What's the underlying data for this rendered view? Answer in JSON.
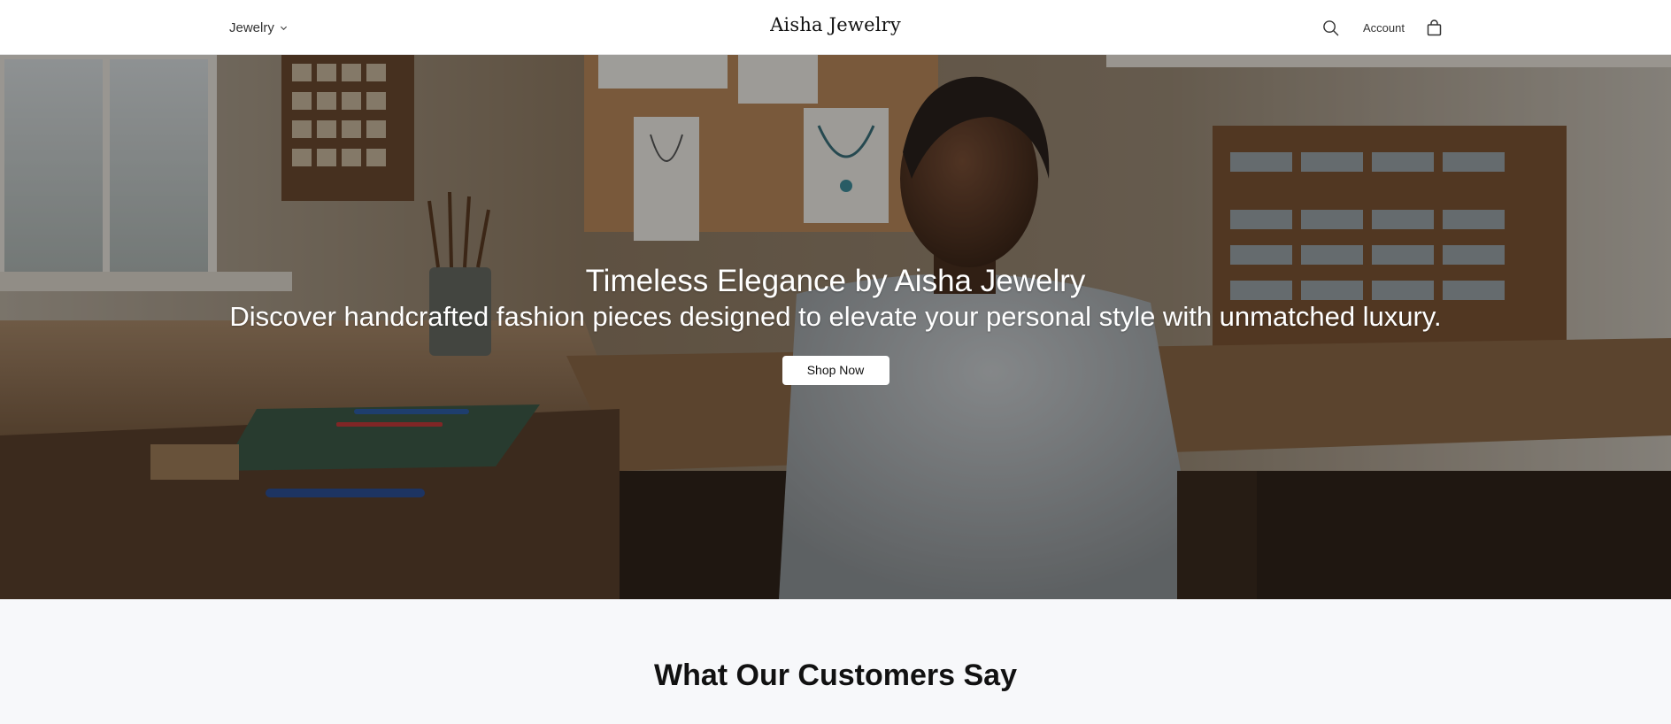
{
  "header": {
    "nav_label": "Jewelry",
    "brand": "Aisha Jewelry",
    "account_label": "Account",
    "icons": {
      "menu_chevron": "chevron-down-icon",
      "search": "search-icon",
      "cart": "shopping-bag-icon"
    }
  },
  "hero": {
    "title": "Timeless Elegance by Aisha Jewelry",
    "subtitle": "Discover handcrafted fashion pieces designed to elevate your personal style with unmatched luxury.",
    "cta_label": "Shop Now",
    "image": "jewelry-artisan-workshop-photo"
  },
  "testimonials": {
    "title": "What Our Customers Say"
  },
  "colors": {
    "header_bg": "#ffffff",
    "section_bg": "#f7f8fa",
    "button_bg": "#ffffff",
    "text_dark": "#111111",
    "hero_text": "#ffffff"
  }
}
